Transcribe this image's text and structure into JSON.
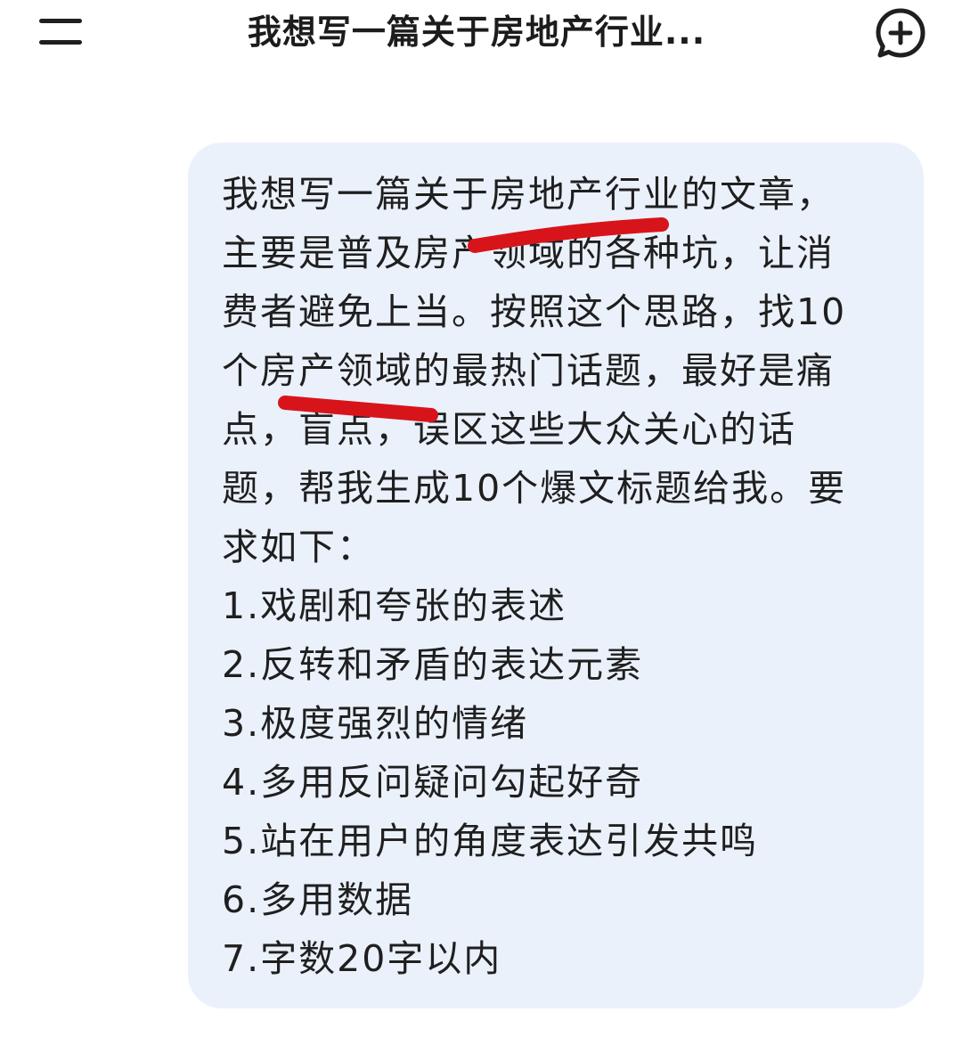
{
  "header": {
    "title": "我想写一篇关于房地产行业...",
    "menu_icon": "hamburger-menu-icon",
    "new_chat_icon": "chat-plus-icon"
  },
  "message": {
    "text": "我想写一篇关于房地产行业的文章，\n主要是普及房产领域的各种坑，让消\n费者避免上当。按照这个思路，找10\n个房产领域的最热门话题，最好是痛\n点，盲点，误区这些大众关心的话\n题，帮我生成10个爆文标题给我。要\n求如下：\n1.戏剧和夸张的表述\n2.反转和矛盾的表达元素\n3.极度强烈的情绪\n4.多用反问疑问勾起好奇\n5.站在用户的角度表达引发共鸣\n6.多用数据\n7.字数20字以内"
  },
  "colors": {
    "bubble_background": "#ebf1fb",
    "annotation_red": "#d8141b",
    "text": "#1f1f1f"
  }
}
